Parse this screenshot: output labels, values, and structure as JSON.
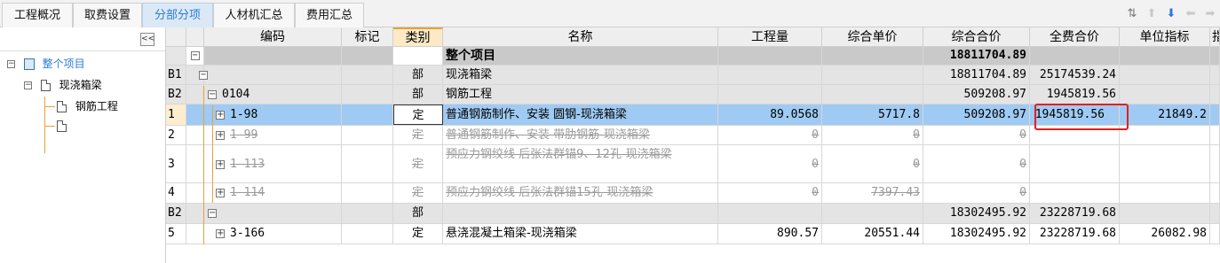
{
  "tabs": [
    {
      "label": "工程概况",
      "active": false
    },
    {
      "label": "取费设置",
      "active": false
    },
    {
      "label": "分部分项",
      "active": true
    },
    {
      "label": "人材机汇总",
      "active": false
    },
    {
      "label": "费用汇总",
      "active": false
    }
  ],
  "toolbar_icons": [
    "sort-icon",
    "arrow-up-icon",
    "arrow-down-icon",
    "arrow-left-icon",
    "arrow-right-icon"
  ],
  "tree": {
    "collapse_label": "<<",
    "nodes": [
      {
        "label": "整个项目",
        "icon": "project-icon",
        "selected": true
      },
      {
        "label": "现浇箱梁",
        "icon": "document-icon"
      },
      {
        "label": "钢筋工程",
        "icon": "document-icon"
      },
      {
        "label": "",
        "icon": "document-icon"
      }
    ]
  },
  "grid": {
    "columns": [
      "编码",
      "标记",
      "类别",
      "名称",
      "工程量",
      "综合单价",
      "综合合价",
      "全费合价",
      "单位指标",
      "指"
    ],
    "rows": [
      {
        "num": "",
        "code": "",
        "mark": "",
        "type": "",
        "name": "整个项目",
        "qty": "",
        "price": "",
        "total": "18811704.89",
        "fulltotal": "",
        "unit": "",
        "kind": "summary"
      },
      {
        "num": "B1",
        "code": "",
        "mark": "",
        "type": "部",
        "name": "现浇箱梁",
        "qty": "",
        "price": "",
        "total": "18811704.89",
        "fulltotal": "25174539.24",
        "unit": "",
        "kind": "section"
      },
      {
        "num": "B2",
        "code": "0104",
        "mark": "",
        "type": "部",
        "name": "钢筋工程",
        "qty": "",
        "price": "",
        "total": "509208.97",
        "fulltotal": "1945819.56",
        "unit": "",
        "kind": "section"
      },
      {
        "num": "1",
        "code": "1-98",
        "mark": "",
        "type": "定",
        "name": "普通钢筋制作、安装 圆钢-现浇箱梁",
        "qty": "89.0568",
        "price": "5717.8",
        "total": "509208.97",
        "fulltotal": "1945819.56",
        "unit": "21849.2",
        "kind": "selected"
      },
      {
        "num": "2",
        "code": "1-99",
        "mark": "",
        "type": "定",
        "name": "普通钢筋制作、安装 带肋钢筋-现浇箱梁",
        "qty": "0",
        "price": "0",
        "total": "0",
        "fulltotal": "",
        "unit": "",
        "kind": "struck"
      },
      {
        "num": "3",
        "code": "1-113",
        "mark": "",
        "type": "定",
        "name": "预应力钢绞线 后张法群锚9、12孔-现浇箱梁",
        "qty": "0",
        "price": "0",
        "total": "0",
        "fulltotal": "",
        "unit": "",
        "kind": "struck"
      },
      {
        "num": "4",
        "code": "1-114",
        "mark": "",
        "type": "定",
        "name": "预应力钢绞线 后张法群锚15孔-现浇箱梁",
        "qty": "0",
        "price": "7397.43",
        "total": "0",
        "fulltotal": "",
        "unit": "",
        "kind": "struck"
      },
      {
        "num": "B2",
        "code": "",
        "mark": "",
        "type": "部",
        "name": "",
        "qty": "",
        "price": "",
        "total": "18302495.92",
        "fulltotal": "23228719.68",
        "unit": "",
        "kind": "section"
      },
      {
        "num": "5",
        "code": "3-166",
        "mark": "",
        "type": "定",
        "name": "悬浇混凝土箱梁-现浇箱梁",
        "qty": "890.57",
        "price": "20551.44",
        "total": "18302495.92",
        "fulltotal": "23228719.68",
        "unit": "26082.98",
        "kind": "normal"
      }
    ]
  }
}
